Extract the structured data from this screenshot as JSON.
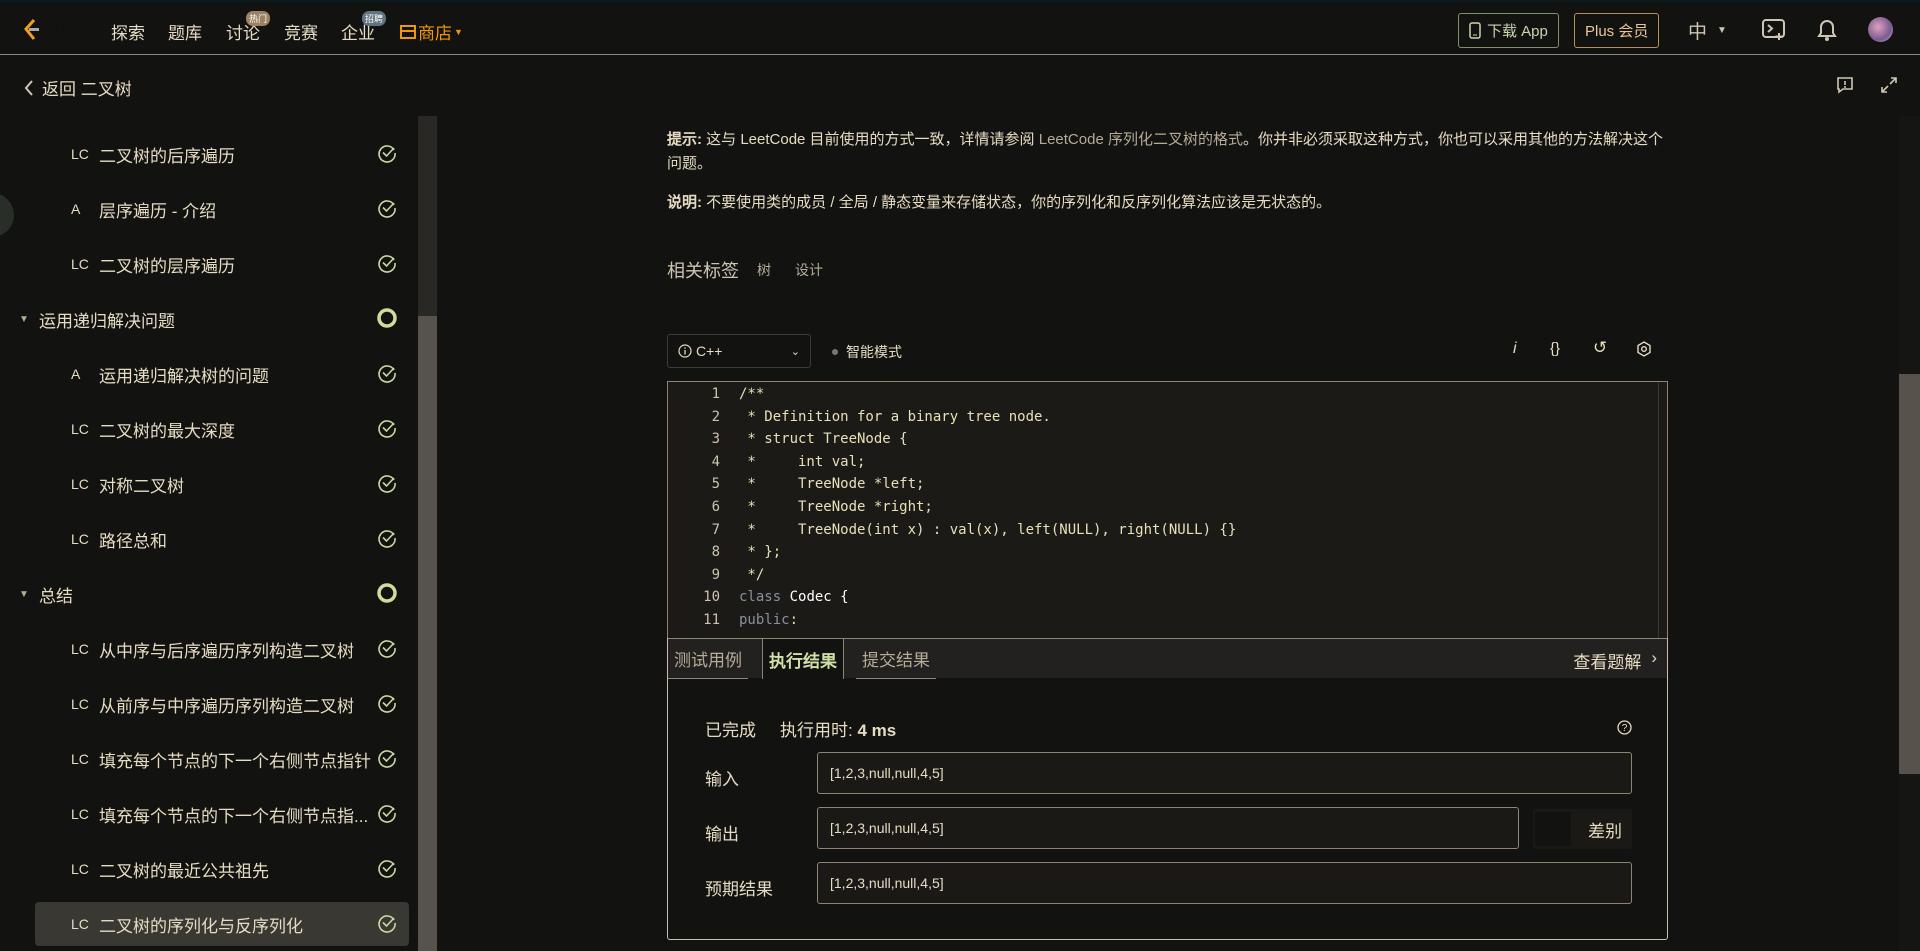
{
  "topbar": {
    "logo_text": "力扣",
    "nav": [
      "探索",
      "题库",
      "讨论",
      "竞赛",
      "企业"
    ],
    "badges": {
      "discuss": "热门",
      "enterprise": "招聘"
    },
    "store": "商店",
    "download": "下载 App",
    "plus": "Plus 会员",
    "lang": "中"
  },
  "subbar": {
    "back": "返回 二叉树"
  },
  "sidebar": {
    "items": [
      {
        "type": "LC",
        "label": "二叉树的后序遍历",
        "status": "done"
      },
      {
        "type": "A",
        "label": "层序遍历 - 介绍",
        "status": "done"
      },
      {
        "type": "LC",
        "label": "二叉树的层序遍历",
        "status": "done"
      },
      {
        "type": "group",
        "label": "运用递归解决问题",
        "status": "ring"
      },
      {
        "type": "A",
        "label": "运用递归解决树的问题",
        "status": "done"
      },
      {
        "type": "LC",
        "label": "二叉树的最大深度",
        "status": "done"
      },
      {
        "type": "LC",
        "label": "对称二叉树",
        "status": "done"
      },
      {
        "type": "LC",
        "label": "路径总和",
        "status": "done"
      },
      {
        "type": "group",
        "label": "总结",
        "status": "ring"
      },
      {
        "type": "LC",
        "label": "从中序与后序遍历序列构造二叉树",
        "status": "done"
      },
      {
        "type": "LC",
        "label": "从前序与中序遍历序列构造二叉树",
        "status": "done"
      },
      {
        "type": "LC",
        "label": "填充每个节点的下一个右侧节点指针",
        "status": "done"
      },
      {
        "type": "LC",
        "label": "填充每个节点的下一个右侧节点指...",
        "status": "done"
      },
      {
        "type": "LC",
        "label": "二叉树的最近公共祖先",
        "status": "done"
      },
      {
        "type": "LC",
        "label": "二叉树的序列化与反序列化",
        "status": "done",
        "active": true
      }
    ]
  },
  "main": {
    "hint_label": "提示:",
    "hint_a": " 这与 LeetCode 目前使用的方式一致，详情请参阅 ",
    "hint_link": "LeetCode 序列化二叉树的格式",
    "hint_b": "。你并非必须采取这种方式，你也可以采用其他的方法解决这个问题。",
    "note_label": "说明:",
    "note": " 不要使用类的成员 / 全局 / 静态变量来存储状态，你的序列化和反序列化算法应该是无状态的。",
    "tags_label": "相关标签",
    "tags": [
      "树",
      "设计"
    ],
    "language": "C++",
    "smart_mode": "智能模式"
  },
  "code": [
    "/**",
    " * Definition for a binary tree node.",
    " * struct TreeNode {",
    " *     int val;",
    " *     TreeNode *left;",
    " *     TreeNode *right;",
    " *     TreeNode(int x) : val(x), left(NULL), right(NULL) {}",
    " * };",
    " */",
    "class Codec {",
    "public:"
  ],
  "results": {
    "tabs": [
      "测试用例",
      "执行结果",
      "提交结果"
    ],
    "active_tab": 1,
    "view_solution": "查看题解",
    "status": "已完成",
    "time_label": "执行用时:",
    "time_value": "4 ms",
    "input_label": "输入",
    "input": "[1,2,3,null,null,4,5]",
    "output_label": "输出",
    "output": "[1,2,3,null,null,4,5]",
    "diff": "差别",
    "expected_label": "预期结果",
    "expected": "[1,2,3,null,null,4,5]"
  },
  "colors": {
    "accent_store": "#f0960a",
    "check": "#c8d8a0",
    "active_tab": "#cfe0a8"
  }
}
